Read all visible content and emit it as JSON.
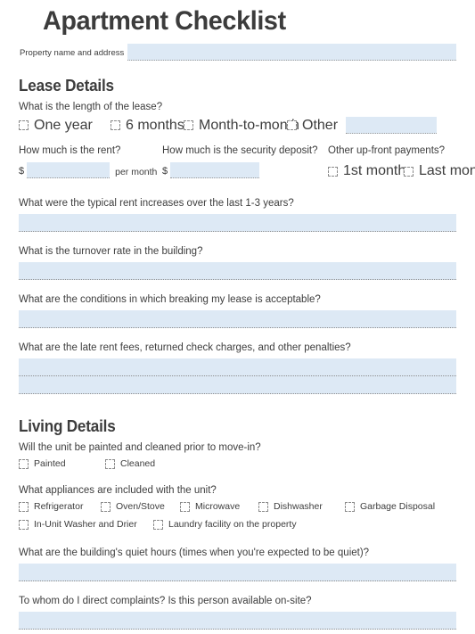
{
  "document": {
    "title": "Apartment Checklist",
    "property_label": "Property name and address",
    "property_value": ""
  },
  "colors": {
    "field_fill": "#dde9f5",
    "text": "#3d3d3d",
    "heading": "#3c3c3c",
    "dotted_rule": "#8e8e8e"
  },
  "lease": {
    "heading": "Lease Details",
    "length_question": "What is the length of the lease?",
    "length_options": [
      {
        "label": "One year",
        "checked": false
      },
      {
        "label": "6 months",
        "checked": false
      },
      {
        "label": "Month-to-month",
        "checked": false
      },
      {
        "label": "Other",
        "checked": false
      }
    ],
    "other_value": "",
    "rent_question": "How much is the rent?",
    "rent_currency": "$",
    "rent_value": "",
    "rent_suffix": "per month",
    "deposit_question": "How much is the security deposit?",
    "deposit_currency": "$",
    "deposit_value": "",
    "upfront_question": "Other up-front payments?",
    "upfront_options": [
      {
        "label": "1st month",
        "checked": false
      },
      {
        "label": "Last month",
        "checked": false
      }
    ],
    "questions": [
      {
        "text": "What were the typical rent increases over the last 1-3 years?",
        "value": "",
        "lines": 1
      },
      {
        "text": "What is the turnover rate in the building?",
        "value": "",
        "lines": 1
      },
      {
        "text": "What are the conditions in which breaking my lease is acceptable?",
        "value": "",
        "lines": 1
      },
      {
        "text": "What are the late rent fees, returned check charges, and other penalties?",
        "value": "",
        "lines": 2
      }
    ]
  },
  "living": {
    "heading": "Living Details",
    "paint_question": "Will the unit be painted and cleaned prior to move-in?",
    "paint_options": [
      {
        "label": "Painted",
        "checked": false
      },
      {
        "label": "Cleaned",
        "checked": false
      }
    ],
    "appliance_question": "What appliances are included with the unit?",
    "appliance_options_row1": [
      {
        "label": "Refrigerator",
        "checked": false
      },
      {
        "label": "Oven/Stove",
        "checked": false
      },
      {
        "label": "Microwave",
        "checked": false
      },
      {
        "label": "Dishwasher",
        "checked": false
      },
      {
        "label": "Garbage Disposal",
        "checked": false
      }
    ],
    "appliance_options_row2": [
      {
        "label": "In-Unit Washer and Drier",
        "checked": false
      },
      {
        "label": "Laundry facility on the property",
        "checked": false
      }
    ],
    "questions": [
      {
        "text": "What are the building's quiet hours (times when you're expected to be quiet)?",
        "value": "",
        "lines": 1
      },
      {
        "text": "To whom do I direct complaints?  Is this person available on-site?",
        "value": "",
        "lines": 1
      }
    ]
  }
}
